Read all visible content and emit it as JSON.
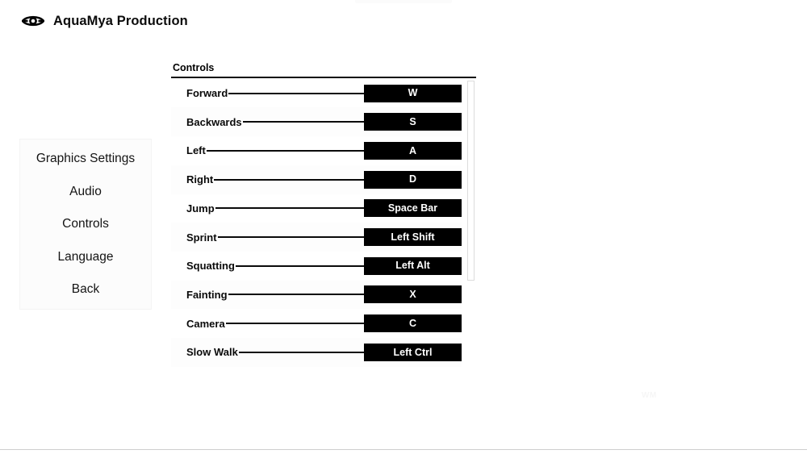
{
  "header": {
    "logo_icon": "eye-icon",
    "title": "AquaMya Production"
  },
  "sidebar": {
    "items": [
      {
        "label": "Graphics Settings"
      },
      {
        "label": "Audio"
      },
      {
        "label": "Controls"
      },
      {
        "label": "Language"
      },
      {
        "label": "Back"
      }
    ]
  },
  "controls_panel": {
    "title": "Controls",
    "rows": [
      {
        "action": "Forward",
        "key": "W"
      },
      {
        "action": "Backwards",
        "key": "S"
      },
      {
        "action": "Left",
        "key": "A"
      },
      {
        "action": "Right",
        "key": "D"
      },
      {
        "action": "Jump",
        "key": "Space Bar"
      },
      {
        "action": "Sprint",
        "key": "Left Shift"
      },
      {
        "action": "Squatting",
        "key": "Left Alt"
      },
      {
        "action": "Fainting",
        "key": "X"
      },
      {
        "action": "Camera",
        "key": "C"
      },
      {
        "action": "Slow Walk",
        "key": "Left Ctrl"
      }
    ]
  },
  "watermark": {
    "text": "WM"
  },
  "colors": {
    "chip_background": "#000000",
    "chip_text": "#ffffff",
    "page_background": "#ffffff",
    "text": "#0a0a0a",
    "panel_background": "#fcfcfc"
  }
}
